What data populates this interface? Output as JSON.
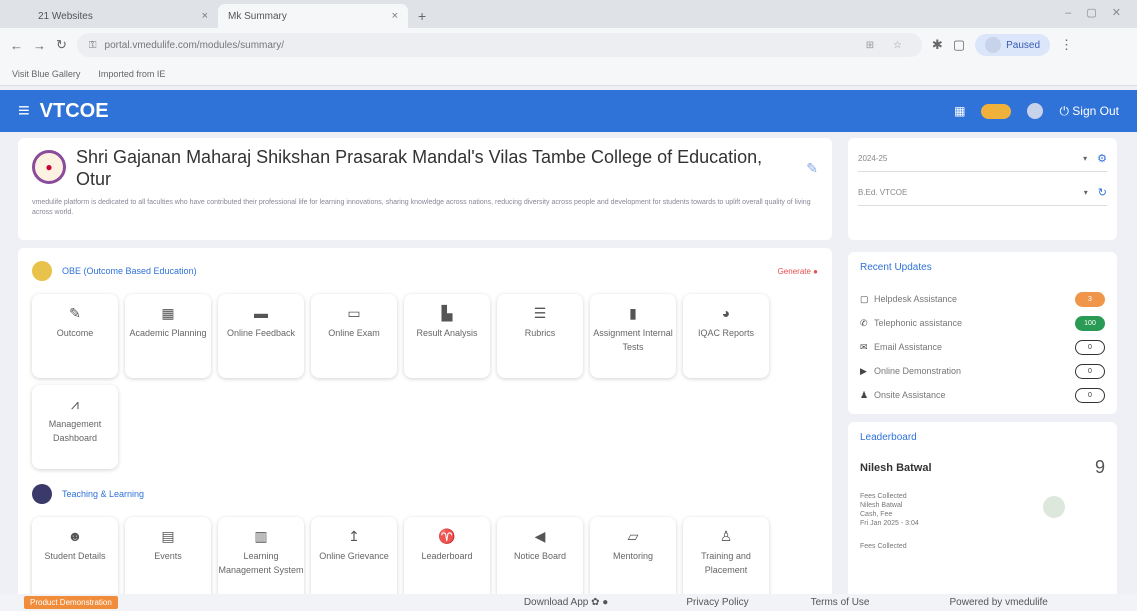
{
  "browser": {
    "tabs": [
      {
        "label": "21 Websites",
        "active": false
      },
      {
        "label": "Mk Summary",
        "active": true
      }
    ],
    "url": "portal.vmedulife.com/modules/summary/",
    "paused_label": "Paused",
    "bookmarks": [
      "Visit Blue Gallery",
      "Imported from IE"
    ]
  },
  "app": {
    "brand": "VTCOE",
    "signout": "Sign Out"
  },
  "institute": {
    "name": "Shri Gajanan Maharaj Shikshan Prasarak Mandal's Vilas Tambe College of Education, Otur",
    "description": "vmedulife platform is dedicated to all faculties who have contributed their professional life for learning innovations, sharing knowledge across nations, reducing diversity across people and development for students towards to uplift overall quality of living across world."
  },
  "selectors": {
    "year": "2024-25",
    "program": "B.Ed. VTCOE"
  },
  "obe": {
    "title": "OBE (Outcome Based Education)",
    "link": "Generate",
    "tiles": [
      {
        "label": "Outcome",
        "icon": "pencil-icon",
        "glyph": "✎"
      },
      {
        "label": "Academic Planning",
        "icon": "building-icon",
        "glyph": "▦"
      },
      {
        "label": "Online Feedback",
        "icon": "comment-icon",
        "glyph": "▬"
      },
      {
        "label": "Online Exam",
        "icon": "folder-icon",
        "glyph": "▭"
      },
      {
        "label": "Result Analysis",
        "icon": "chart-icon",
        "glyph": "▙"
      },
      {
        "label": "Rubrics",
        "icon": "list-icon",
        "glyph": "☰"
      },
      {
        "label": "Assignment Internal Tests",
        "icon": "book-icon",
        "glyph": "▮"
      },
      {
        "label": "IQAC Reports",
        "icon": "pie-icon",
        "glyph": "◕"
      },
      {
        "label": "Management Dashboard",
        "icon": "line-chart-icon",
        "glyph": "⩘"
      }
    ]
  },
  "teaching": {
    "title": "Teaching & Learning",
    "tiles": [
      {
        "label": "Student Details",
        "icon": "users-icon",
        "glyph": "☻"
      },
      {
        "label": "Events",
        "icon": "calendar-icon",
        "glyph": "▤"
      },
      {
        "label": "Learning Management System",
        "icon": "book-icon",
        "glyph": "▥"
      },
      {
        "label": "Online Grievance",
        "icon": "flag-icon",
        "glyph": "↥"
      },
      {
        "label": "Leaderboard",
        "icon": "trophy-icon",
        "glyph": "♈"
      },
      {
        "label": "Notice Board",
        "icon": "megaphone-icon",
        "glyph": "◀"
      },
      {
        "label": "Mentoring",
        "icon": "chat-icon",
        "glyph": "▱"
      },
      {
        "label": "Training and Placement",
        "icon": "user-tie-icon",
        "glyph": "♙"
      }
    ]
  },
  "recent_updates": {
    "title": "Recent Updates",
    "items": [
      {
        "label": "Helpdesk Assistance",
        "icon": "monitor-icon",
        "glyph": "▢",
        "count": "3",
        "style": "orange"
      },
      {
        "label": "Telephonic assistance",
        "icon": "phone-icon",
        "glyph": "✆",
        "count": "100",
        "style": "green"
      },
      {
        "label": "Email Assistance",
        "icon": "mail-icon",
        "glyph": "✉",
        "count": "0",
        "style": "outline"
      },
      {
        "label": "Online Demonstration",
        "icon": "video-icon",
        "glyph": "▶",
        "count": "0",
        "style": "outline"
      },
      {
        "label": "Onsite Assistance",
        "icon": "user-icon",
        "glyph": "♟",
        "count": "0",
        "style": "outline"
      }
    ]
  },
  "leaderboard": {
    "title": "Leaderboard",
    "name": "Nilesh Batwal",
    "score": "9",
    "entries": [
      {
        "title": "Fees Collected",
        "who": "Nilesh Batwal",
        "line": "Cash, Fee",
        "date": "Fri Jan 2025 - 3:04"
      },
      {
        "title": "Fees Collected",
        "who": "",
        "line": "",
        "date": ""
      }
    ]
  },
  "footer": {
    "demo": "Product Demonstration",
    "download": "Download App",
    "privacy": "Privacy Policy",
    "terms": "Terms of Use",
    "powered": "Powered by vmedulife"
  },
  "colors": {
    "primary": "#2f72d8",
    "orange": "#f0964a",
    "green": "#2a9b54"
  }
}
